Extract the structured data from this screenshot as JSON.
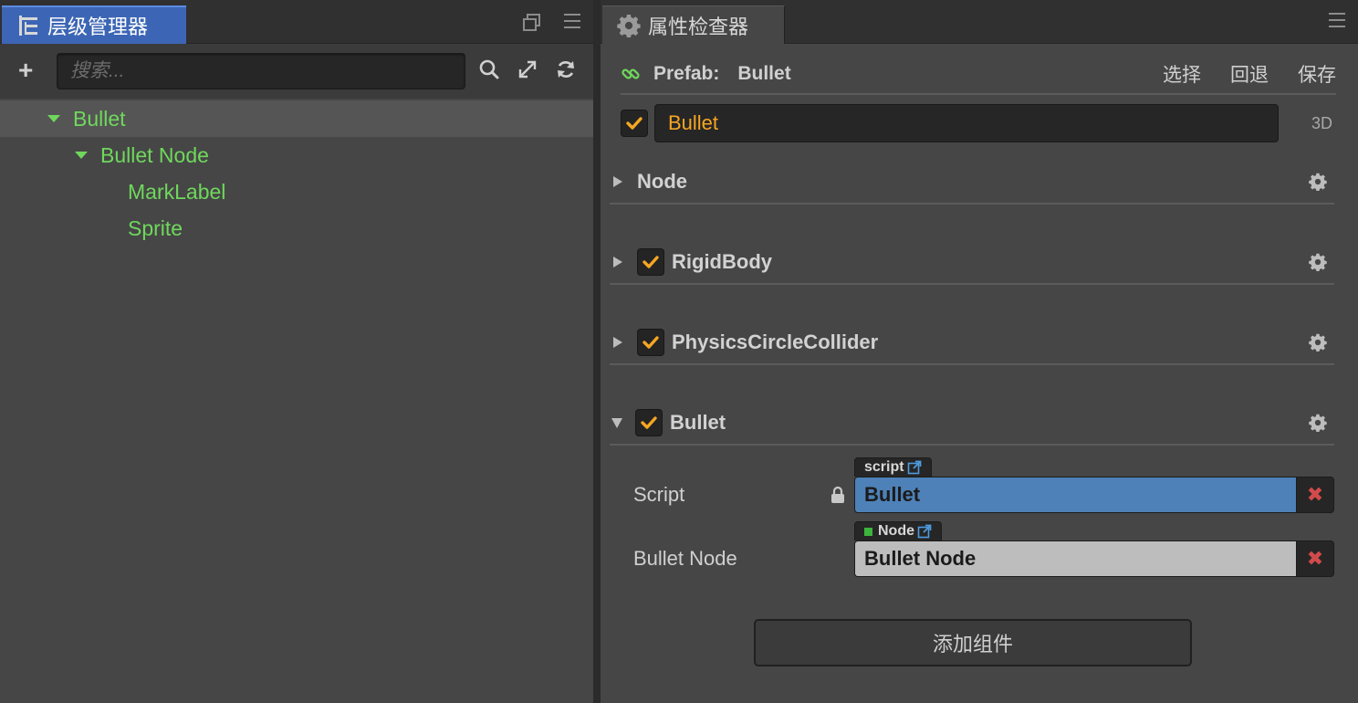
{
  "hierarchy": {
    "tab_title": "层级管理器",
    "search_placeholder": "搜索...",
    "tree": [
      {
        "label": "Bullet"
      },
      {
        "label": "Bullet Node"
      },
      {
        "label": "MarkLabel"
      },
      {
        "label": "Sprite"
      }
    ]
  },
  "inspector": {
    "tab_title": "属性检查器",
    "prefab": {
      "label": "Prefab:",
      "name": "Bullet",
      "actions": [
        "选择",
        "回退",
        "保存"
      ]
    },
    "node_name": "Bullet",
    "mode_3d": "3D",
    "components": [
      {
        "title": "Node"
      },
      {
        "title": "RigidBody"
      },
      {
        "title": "PhysicsCircleCollider"
      },
      {
        "title": "Bullet"
      }
    ],
    "props": [
      {
        "label": "Script",
        "tag": "script",
        "value": "Bullet"
      },
      {
        "label": "Bullet Node",
        "tag": "Node",
        "value": "Bullet Node"
      }
    ],
    "add_component": "添加组件"
  },
  "colors": {
    "accent_tab": "#3c66b5",
    "tree_green": "#6fd85c",
    "check_orange": "#f5a623",
    "script_blue": "#4e81b8",
    "remove_red": "#d24b4b"
  },
  "icons": [
    "tree-icon",
    "restore-icon",
    "menu-icon",
    "plus-icon",
    "search-icon",
    "expand-icon",
    "refresh-icon",
    "gear-icon",
    "link-icon",
    "lock-icon",
    "external-link-icon",
    "close-icon",
    "checkmark-icon"
  ]
}
